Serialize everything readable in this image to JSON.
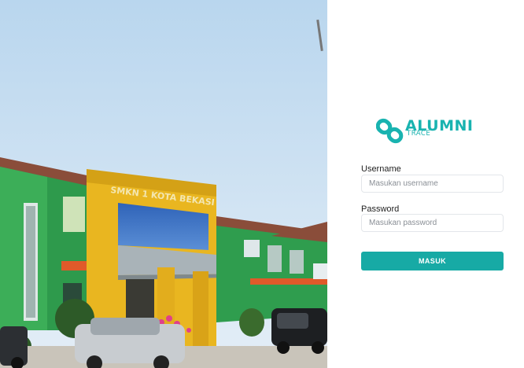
{
  "photo": {
    "sign_text": "SMKN 1 KOTA BEKASI"
  },
  "brand": {
    "title": "ALUMNI",
    "subtitle": "TRACE",
    "icon": "chain-link-icon",
    "accent_color": "#19b3b0"
  },
  "form": {
    "username_label": "Username",
    "username_placeholder": "Masukan username",
    "password_label": "Password",
    "password_placeholder": "Masukan password",
    "submit_label": "MASUK",
    "button_color": "#17aaa5"
  }
}
